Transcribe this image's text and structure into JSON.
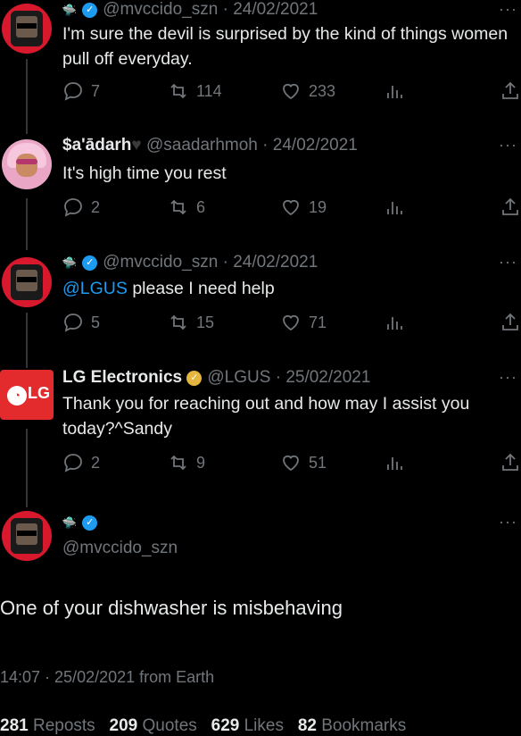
{
  "tweets": [
    {
      "handle": "@mvccido_szn",
      "date": "24/02/2021",
      "text": "I'm sure the devil is surprised by the kind of things women pull off everyday.",
      "replies": "7",
      "reposts": "114",
      "likes": "233"
    },
    {
      "name": "$a'ādarh",
      "handle": "@saadarhmoh",
      "date": "24/02/2021",
      "text": "It's high time you rest",
      "replies": "2",
      "reposts": "6",
      "likes": "19"
    },
    {
      "handle": "@mvccido_szn",
      "date": "24/02/2021",
      "mention": "@LGUS",
      "text": " please I need help",
      "replies": "5",
      "reposts": "15",
      "likes": "71"
    },
    {
      "name": "LG Electronics",
      "handle": "@LGUS",
      "date": "25/02/2021",
      "text": "Thank you for reaching out and how may I assist you today?^Sandy",
      "replies": "2",
      "reposts": "9",
      "likes": "51"
    }
  ],
  "main": {
    "handle": "@mvccido_szn",
    "text": "One of your dishwasher is misbehaving",
    "time": "14:07 · 25/02/2021 from Earth",
    "stats": {
      "reposts_count": "281",
      "reposts_label": "Reposts",
      "quotes_count": "209",
      "quotes_label": "Quotes",
      "likes_count": "629",
      "likes_label": "Likes",
      "bookmarks_count": "82",
      "bookmarks_label": "Bookmarks"
    }
  },
  "avatar_lg_text": "LG",
  "icons": [
    "reply-icon",
    "repost-icon",
    "like-icon",
    "views-icon",
    "share-icon",
    "verified-badge-icon",
    "more-icon"
  ],
  "colors": {
    "link": "#1d9bf0",
    "muted": "#71767b",
    "verified": "#1d9bf0",
    "verified_gold": "#e5b53f",
    "lg_red": "#e32b2e"
  }
}
